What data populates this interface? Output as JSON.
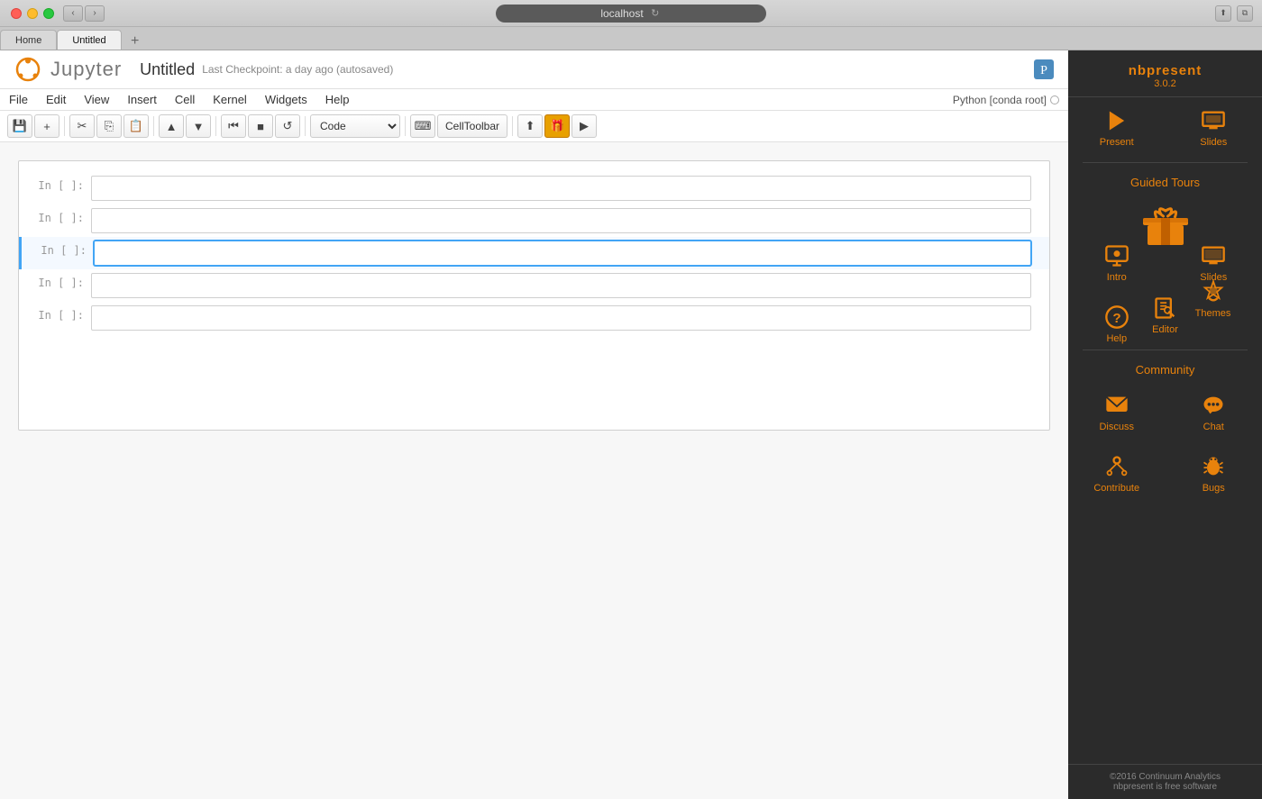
{
  "titlebar": {
    "url": "localhost",
    "refresh_label": "↻"
  },
  "tabs": [
    {
      "label": "Home",
      "active": false
    },
    {
      "label": "Untitled",
      "active": true
    }
  ],
  "notebook": {
    "title": "Untitled",
    "checkpoint": "Last Checkpoint: a day ago (autosaved)",
    "kernel": "Python [conda root]",
    "menus": [
      "File",
      "Edit",
      "View",
      "Insert",
      "Cell",
      "Kernel",
      "Widgets",
      "Help"
    ],
    "cell_type": "Code",
    "celltoolbar": "CellToolbar",
    "cells": [
      {
        "label": "In [ ]:",
        "selected": false
      },
      {
        "label": "In [ ]:",
        "selected": false
      },
      {
        "label": "In [ ]:",
        "selected": true
      },
      {
        "label": "In [ ]:",
        "selected": false
      },
      {
        "label": "In [ ]:",
        "selected": false
      }
    ]
  },
  "sidebar": {
    "nbpresent_title": "nbpresent",
    "nbpresent_version": "3.0.2",
    "present_label": "Present",
    "slides_label": "Slides",
    "guided_tours_title": "Guided Tours",
    "intro_label": "Intro",
    "slides_guided_label": "Slides",
    "help_label": "Help",
    "editor_label": "Editor",
    "themes_label": "Themes",
    "community_title": "Community",
    "discuss_label": "Discuss",
    "chat_label": "Chat",
    "contribute_label": "Contribute",
    "bugs_label": "Bugs",
    "footer_line1": "©2016 Continuum Analytics",
    "footer_line2": "nbpresent is free software"
  }
}
